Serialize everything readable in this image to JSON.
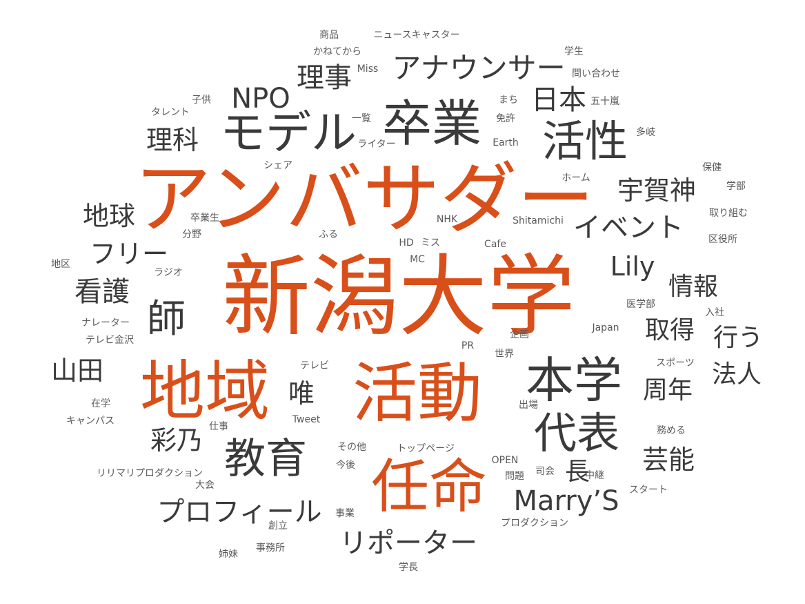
{
  "colors": {
    "accent": "#d94f1a",
    "dark": "#3a3a3a",
    "light": "#5a5a5a",
    "background": "#ffffff"
  },
  "words": [
    {
      "text": "新潟大学",
      "weight": 100,
      "color": "accent"
    },
    {
      "text": "アンバサダー",
      "weight": 88,
      "color": "accent"
    },
    {
      "text": "地域",
      "weight": 80,
      "color": "accent"
    },
    {
      "text": "活動",
      "weight": 80,
      "color": "accent"
    },
    {
      "text": "任命",
      "weight": 72,
      "color": "accent"
    },
    {
      "text": "卒業",
      "weight": 60,
      "color": "dark"
    },
    {
      "text": "モデル",
      "weight": 52,
      "color": "dark"
    },
    {
      "text": "本学",
      "weight": 56,
      "color": "dark"
    },
    {
      "text": "活性",
      "weight": 50,
      "color": "dark"
    },
    {
      "text": "代表",
      "weight": 50,
      "color": "dark"
    },
    {
      "text": "教育",
      "weight": 50,
      "color": "dark"
    },
    {
      "text": "アナウンサー",
      "weight": 36,
      "color": "dark"
    },
    {
      "text": "NPO",
      "weight": 36,
      "color": "dark"
    },
    {
      "text": "理事",
      "weight": 36,
      "color": "dark"
    },
    {
      "text": "日本",
      "weight": 36,
      "color": "dark"
    },
    {
      "text": "理科",
      "weight": 34,
      "color": "dark"
    },
    {
      "text": "宇賀神",
      "weight": 34,
      "color": "dark"
    },
    {
      "text": "イベント",
      "weight": 34,
      "color": "dark"
    },
    {
      "text": "地球",
      "weight": 34,
      "color": "dark"
    },
    {
      "text": "フリー",
      "weight": 34,
      "color": "dark"
    },
    {
      "text": "Lily",
      "weight": 34,
      "color": "dark"
    },
    {
      "text": "看護",
      "weight": 36,
      "color": "dark"
    },
    {
      "text": "師",
      "weight": 50,
      "color": "dark"
    },
    {
      "text": "情報",
      "weight": 34,
      "color": "dark"
    },
    {
      "text": "取得",
      "weight": 34,
      "color": "dark"
    },
    {
      "text": "行う",
      "weight": 34,
      "color": "dark"
    },
    {
      "text": "山田",
      "weight": 34,
      "color": "dark"
    },
    {
      "text": "唯",
      "weight": 34,
      "color": "dark"
    },
    {
      "text": "周年",
      "weight": 34,
      "color": "dark"
    },
    {
      "text": "法人",
      "weight": 34,
      "color": "dark"
    },
    {
      "text": "彩乃",
      "weight": 34,
      "color": "dark"
    },
    {
      "text": "芸能",
      "weight": 34,
      "color": "dark"
    },
    {
      "text": "長",
      "weight": 34,
      "color": "dark"
    },
    {
      "text": "Marry’S",
      "weight": 36,
      "color": "dark"
    },
    {
      "text": "プロフィール",
      "weight": 36,
      "color": "dark"
    },
    {
      "text": "リポーター",
      "weight": 36,
      "color": "dark"
    },
    {
      "text": "商品",
      "weight": 12,
      "color": "light"
    },
    {
      "text": "ニュースキャスター",
      "weight": 12,
      "color": "light"
    },
    {
      "text": "かねてから",
      "weight": 12,
      "color": "light"
    },
    {
      "text": "学生",
      "weight": 12,
      "color": "light"
    },
    {
      "text": "Miss",
      "weight": 12,
      "color": "light"
    },
    {
      "text": "問い合わせ",
      "weight": 12,
      "color": "light"
    },
    {
      "text": "子供",
      "weight": 12,
      "color": "light"
    },
    {
      "text": "まち",
      "weight": 12,
      "color": "light"
    },
    {
      "text": "五十嵐",
      "weight": 12,
      "color": "light"
    },
    {
      "text": "タレント",
      "weight": 12,
      "color": "light"
    },
    {
      "text": "一覧",
      "weight": 12,
      "color": "light"
    },
    {
      "text": "免許",
      "weight": 12,
      "color": "light"
    },
    {
      "text": "多岐",
      "weight": 12,
      "color": "light"
    },
    {
      "text": "ライター",
      "weight": 12,
      "color": "light"
    },
    {
      "text": "Earth",
      "weight": 12,
      "color": "light"
    },
    {
      "text": "シェア",
      "weight": 12,
      "color": "light"
    },
    {
      "text": "保健",
      "weight": 12,
      "color": "light"
    },
    {
      "text": "ホーム",
      "weight": 12,
      "color": "light"
    },
    {
      "text": "学部",
      "weight": 12,
      "color": "light"
    },
    {
      "text": "取り組む",
      "weight": 12,
      "color": "light"
    },
    {
      "text": "卒業生",
      "weight": 12,
      "color": "light"
    },
    {
      "text": "NHK",
      "weight": 12,
      "color": "light"
    },
    {
      "text": "Shitamichi",
      "weight": 12,
      "color": "light"
    },
    {
      "text": "分野",
      "weight": 12,
      "color": "light"
    },
    {
      "text": "ふる",
      "weight": 12,
      "color": "light"
    },
    {
      "text": "区役所",
      "weight": 12,
      "color": "light"
    },
    {
      "text": "HD",
      "weight": 12,
      "color": "light"
    },
    {
      "text": "ミス",
      "weight": 12,
      "color": "light"
    },
    {
      "text": "Cafe",
      "weight": 12,
      "color": "light"
    },
    {
      "text": "地区",
      "weight": 12,
      "color": "light"
    },
    {
      "text": "MC",
      "weight": 12,
      "color": "light"
    },
    {
      "text": "ラジオ",
      "weight": 12,
      "color": "light"
    },
    {
      "text": "医学部",
      "weight": 12,
      "color": "light"
    },
    {
      "text": "入社",
      "weight": 12,
      "color": "light"
    },
    {
      "text": "ナレーター",
      "weight": 12,
      "color": "light"
    },
    {
      "text": "Japan",
      "weight": 12,
      "color": "light"
    },
    {
      "text": "テレビ金沢",
      "weight": 12,
      "color": "light"
    },
    {
      "text": "企画",
      "weight": 12,
      "color": "light"
    },
    {
      "text": "PR",
      "weight": 12,
      "color": "light"
    },
    {
      "text": "世界",
      "weight": 12,
      "color": "light"
    },
    {
      "text": "テレビ",
      "weight": 12,
      "color": "light"
    },
    {
      "text": "スポーツ",
      "weight": 12,
      "color": "light"
    },
    {
      "text": "在学",
      "weight": 12,
      "color": "light"
    },
    {
      "text": "出場",
      "weight": 12,
      "color": "light"
    },
    {
      "text": "キャンパス",
      "weight": 12,
      "color": "light"
    },
    {
      "text": "Tweet",
      "weight": 12,
      "color": "light"
    },
    {
      "text": "仕事",
      "weight": 12,
      "color": "light"
    },
    {
      "text": "務める",
      "weight": 12,
      "color": "light"
    },
    {
      "text": "その他",
      "weight": 12,
      "color": "light"
    },
    {
      "text": "トップページ",
      "weight": 12,
      "color": "light"
    },
    {
      "text": "今後",
      "weight": 12,
      "color": "light"
    },
    {
      "text": "OPEN",
      "weight": 12,
      "color": "light"
    },
    {
      "text": "リリマリプロダクション",
      "weight": 12,
      "color": "light"
    },
    {
      "text": "司会",
      "weight": 12,
      "color": "light"
    },
    {
      "text": "問題",
      "weight": 12,
      "color": "light"
    },
    {
      "text": "中継",
      "weight": 12,
      "color": "light"
    },
    {
      "text": "大会",
      "weight": 12,
      "color": "light"
    },
    {
      "text": "スタート",
      "weight": 12,
      "color": "light"
    },
    {
      "text": "事業",
      "weight": 12,
      "color": "light"
    },
    {
      "text": "プロダクション",
      "weight": 12,
      "color": "light"
    },
    {
      "text": "創立",
      "weight": 12,
      "color": "light"
    },
    {
      "text": "事務所",
      "weight": 12,
      "color": "light"
    },
    {
      "text": "姉妹",
      "weight": 12,
      "color": "light"
    },
    {
      "text": "学長",
      "weight": 12,
      "color": "light"
    }
  ]
}
